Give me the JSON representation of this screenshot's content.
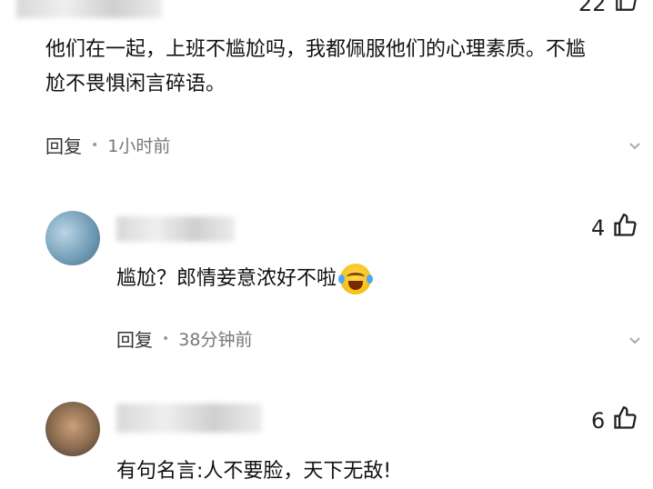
{
  "comments": [
    {
      "likes": "22",
      "text": "他们在一起，上班不尴尬吗，我都佩服他们的心理素质。不尴尬不畏惧闲言碎语。",
      "reply_label": "回复",
      "time": "1小时前"
    },
    {
      "likes": "4",
      "text": "尴尬？郎情妾意浓好不啦",
      "reply_label": "回复",
      "time": "38分钟前"
    },
    {
      "likes": "6",
      "text": "有句名言:人不要脸，天下无敌!"
    }
  ],
  "icons": {
    "like": "thumbs-up-icon",
    "more": "chevron-down-icon",
    "emoji": "laughing-crying-emoji"
  }
}
